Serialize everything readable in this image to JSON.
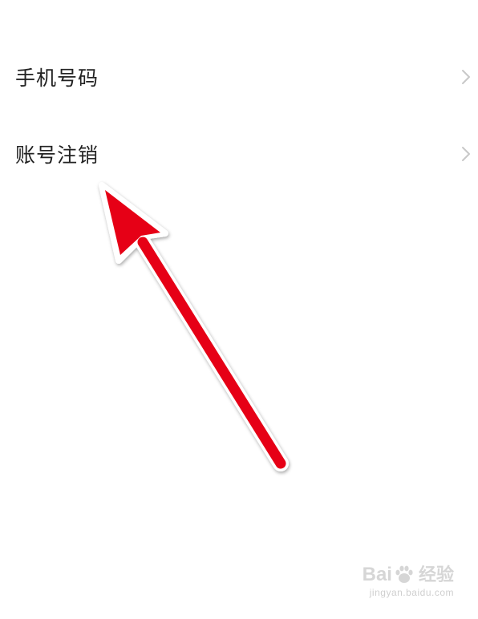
{
  "settings": {
    "items": [
      {
        "label": "手机号码",
        "chevron_icon": "chevron-right-icon"
      },
      {
        "label": "账号注销",
        "chevron_icon": "chevron-right-icon"
      }
    ]
  },
  "annotation": {
    "type": "arrow",
    "color": "#e60012",
    "outline_color": "#ffffff",
    "points_to": "账号注销"
  },
  "watermark": {
    "logo_prefix": "Bai",
    "logo_icon": "paw-icon",
    "logo_suffix": "经验",
    "url": "jingyan.baidu.com"
  },
  "colors": {
    "background": "#ffffff",
    "label_text": "#222222",
    "chevron": "#c8c8c8",
    "watermark": "#d6d6d6"
  }
}
